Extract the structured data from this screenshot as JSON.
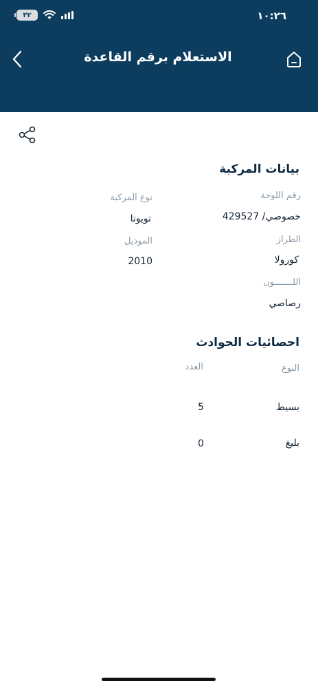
{
  "status_bar": {
    "time": "١٠:٢٦",
    "battery": "٣٢"
  },
  "header": {
    "title": "الاستعلام برقم القاعدة"
  },
  "vehicle_section": {
    "title": "بيانات المركبة",
    "fields": {
      "plate_label": "رقم اللوحة",
      "plate_value": "خصوصي/ 429527",
      "type_label": "نوع المركبة",
      "type_value": "تويوتا",
      "model_label": "الطراز",
      "model_value": "كورولا",
      "year_label": "الموديل",
      "year_value": "2010",
      "color_label": "اللـــــــون",
      "color_value": "رصاصي"
    }
  },
  "accidents_section": {
    "title": "احصائيات الحوادث",
    "columns": {
      "type": "النوع",
      "count": "العدد"
    },
    "rows": [
      {
        "type": "بسيط",
        "count": "5"
      },
      {
        "type": "بليغ",
        "count": "0"
      }
    ]
  }
}
